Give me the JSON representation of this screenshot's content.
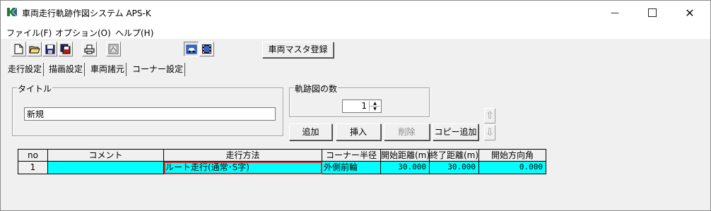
{
  "window": {
    "title": "車両走行軌跡作図システム APS-K",
    "controls": {
      "minimize": "—",
      "maximize": "",
      "close": "✕"
    }
  },
  "menu": [
    {
      "label": "ファイル(F)"
    },
    {
      "label": "オプション(O)"
    },
    {
      "label": "ヘルプ(H)"
    }
  ],
  "toolbar": {
    "icons": [
      "new-file-icon",
      "open-folder-icon",
      "save-icon",
      "save-as-icon",
      "print-icon",
      "preview-icon",
      "vehicle-view-icon",
      "film-icon"
    ],
    "register_button": "車両マスタ登録"
  },
  "tabs": [
    {
      "label": "走行設定",
      "active": true
    },
    {
      "label": "描画設定",
      "active": false
    },
    {
      "label": "車両諸元",
      "active": false
    },
    {
      "label": "コーナー設定",
      "active": false
    }
  ],
  "title_group": {
    "legend": "タイトル",
    "value": "新規"
  },
  "count_group": {
    "legend": "軌跡図の数",
    "value": "1"
  },
  "actions": {
    "add": "追加",
    "insert": "挿入",
    "delete": "削除",
    "copy_add": "コピー追加"
  },
  "arrows": {
    "up": "⇧",
    "down": "⇩"
  },
  "grid": {
    "columns": [
      "no",
      "コメント",
      "走行方法",
      "コーナー半径",
      "開始距離(m)",
      "終了距離(m)",
      "開始方向角"
    ],
    "rows": [
      {
        "no": "1",
        "comment": "",
        "method": "ルート走行(通常･S字)",
        "corner": "外側前輪",
        "start": "30.000",
        "end": "30.000",
        "angle": "0.000"
      }
    ]
  },
  "colors": {
    "cell_fill": "#00ffff",
    "selection_border": "#d9302e"
  }
}
